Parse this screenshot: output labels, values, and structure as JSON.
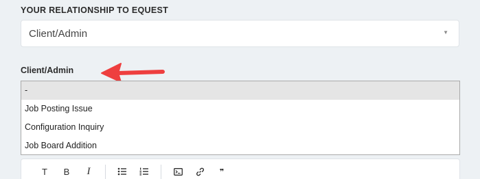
{
  "relationship": {
    "label": "YOUR RELATIONSHIP TO EQUEST",
    "selected_value": "Client/Admin",
    "caret_icon": "▼"
  },
  "client_admin": {
    "label": "Client/Admin",
    "options": [
      {
        "label": "-",
        "selected": true
      },
      {
        "label": "Job Posting Issue",
        "selected": false
      },
      {
        "label": "Configuration Inquiry",
        "selected": false
      },
      {
        "label": "Job Board Addition",
        "selected": false
      }
    ]
  },
  "annotation": {
    "arrow_color": "#ee3f3f"
  },
  "toolbar": {
    "text_style_glyph": "T",
    "bold_glyph": "B",
    "italic_glyph": "I",
    "quote_glyph": "❞"
  }
}
